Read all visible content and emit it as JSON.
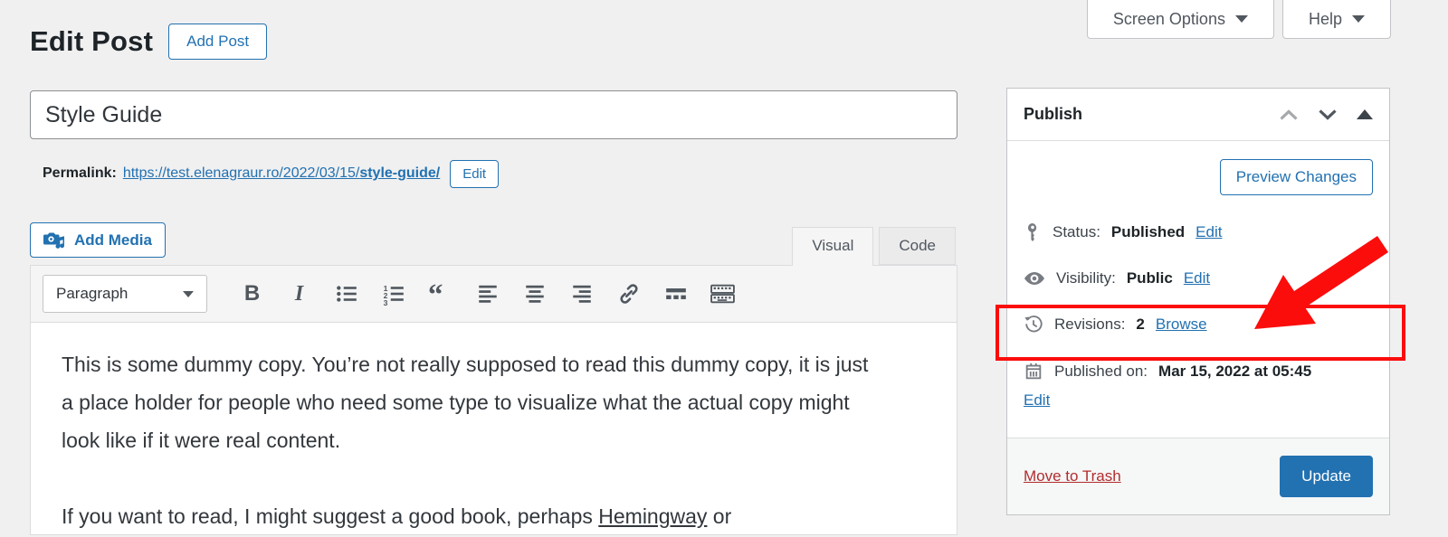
{
  "colors": {
    "accent_blue": "#2271b1",
    "annotation_red": "#fb0d0c",
    "trash_red": "#b32d2e",
    "page_background": "#f0f0f1"
  },
  "top_tabs": {
    "screen_options": "Screen Options",
    "help": "Help"
  },
  "header": {
    "page_title": "Edit Post",
    "add_post_button": "Add Post"
  },
  "post": {
    "title_value": "Style Guide"
  },
  "permalink": {
    "label": "Permalink:",
    "url_prefix": "https://test.elenagraur.ro/2022/03/15/",
    "url_slug": "style-guide/",
    "edit_button": "Edit"
  },
  "editor": {
    "add_media_button": "Add Media",
    "tabs": {
      "visual": "Visual",
      "code": "Code"
    },
    "toolbar": {
      "block_format": "Paragraph",
      "bold_glyph": "B",
      "italic_glyph": "I",
      "icons": [
        "bulleted-list",
        "numbered-list",
        "blockquote",
        "align-left",
        "align-center",
        "align-right",
        "link",
        "read-more",
        "keyboard-shortcuts"
      ]
    },
    "content": {
      "paragraph_1": "This is some dummy copy. You’re not really supposed to read this dummy copy, it is just a place holder for people who need some type to visualize what the actual copy might look like if it were real content.",
      "paragraph_2_before": "If you want to read, I might suggest a good book, perhaps ",
      "paragraph_2_link": "Hemingway",
      "paragraph_2_after": " or"
    }
  },
  "publish_panel": {
    "title": "Publish",
    "preview_changes_button": "Preview Changes",
    "status": {
      "label": "Status:",
      "value": "Published",
      "action": "Edit"
    },
    "visibility": {
      "label": "Visibility:",
      "value": "Public",
      "action": "Edit"
    },
    "revisions": {
      "label": "Revisions:",
      "value": "2",
      "action": "Browse"
    },
    "published_on": {
      "label": "Published on:",
      "value": "Mar 15, 2022 at 05:45",
      "action": "Edit"
    },
    "move_to_trash": "Move to Trash",
    "update_button": "Update"
  }
}
